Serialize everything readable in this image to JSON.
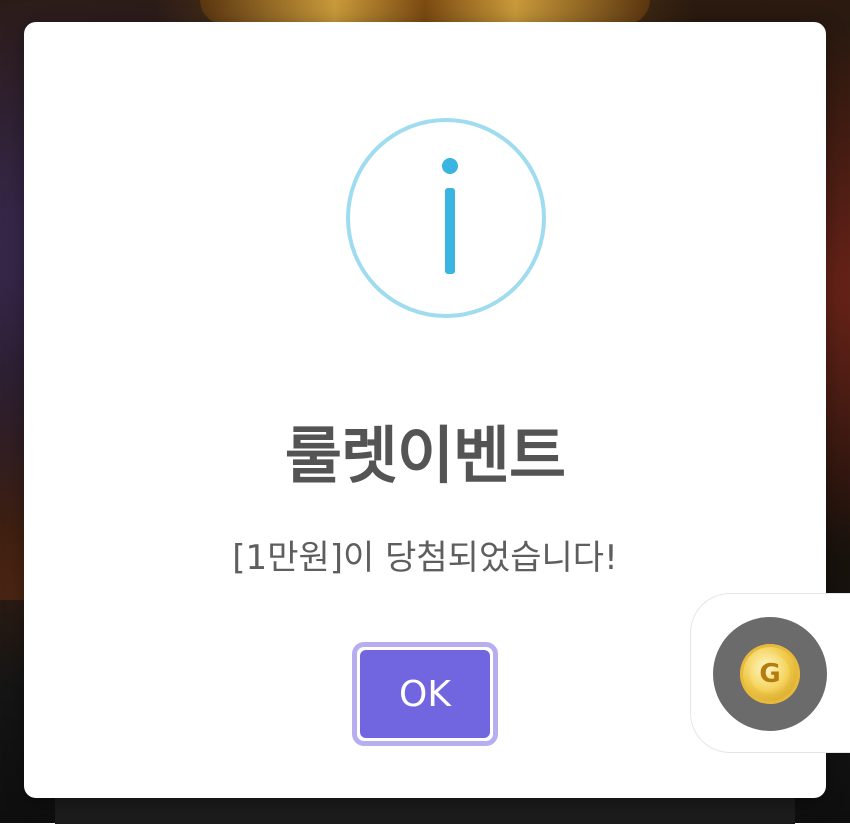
{
  "dialog": {
    "icon": "info-icon",
    "title": "룰렛이벤트",
    "message": "[1만원]이 당첨되었습니다!",
    "ok_label": "OK",
    "accent_color": "#7266e0",
    "icon_color": "#3ab4e0"
  },
  "floating_widget": {
    "icon": "gold-coin-icon",
    "icon_letter": "G"
  }
}
